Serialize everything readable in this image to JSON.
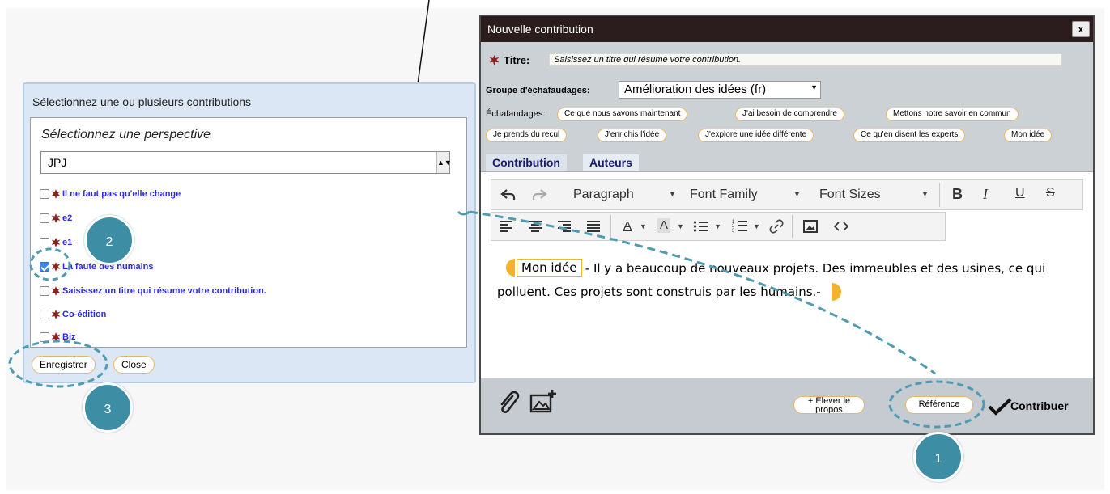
{
  "select_dialog": {
    "title": "Sélectionnez une ou plusieurs contributions",
    "perspective_label": "Sélectionnez une perspective",
    "perspective_value": "JPJ",
    "items": [
      {
        "label": "Il ne faut pas qu'elle change",
        "checked": false
      },
      {
        "label": "e2",
        "checked": false
      },
      {
        "label": "e1",
        "checked": false
      },
      {
        "label": "La faute des humains",
        "checked": true
      },
      {
        "label": "Saisissez un titre qui résume votre contribution.",
        "checked": false
      },
      {
        "label": "Co-édition",
        "checked": false
      },
      {
        "label": "Biz",
        "checked": false
      }
    ],
    "save_label": "Enregistrer",
    "close_label": "Close"
  },
  "editor": {
    "window_title": "Nouvelle contribution",
    "close_glyph": "x",
    "title_label": "Titre:",
    "title_placeholder": "Saisissez un titre qui résume votre contribution.",
    "scaffold_group_label": "Groupe d'échafaudages:",
    "scaffold_group_value": "Amélioration des idées (fr)",
    "scaffolds_label": "Échafaudages:",
    "scaffolds": [
      "Ce que nous savons maintenant",
      "J'ai besoin de comprendre",
      "Mettons notre savoir en commun",
      "Je prends du recul",
      "J'enrichis l'idée",
      "J'explore une idée différente",
      "Ce qu'en disent les experts",
      "Mon idée"
    ],
    "tabs": [
      "Contribution",
      "Auteurs"
    ],
    "toolbar": {
      "paragraph": "Paragraph",
      "font_family": "Font Family",
      "font_sizes": "Font Sizes",
      "bold": "B",
      "italic": "I",
      "underline": "U",
      "strike": "S",
      "text_color": "A",
      "bg_color": "A"
    },
    "body": {
      "scaffold_tag": "Mon idée",
      "text_line1": " - Il y a beaucoup de nouveaux projets. Des immeubles et des usines, ce qui",
      "text_line2": "polluent. Ces projets sont construis par les humains.-"
    },
    "footer": {
      "elevate_label": "+ Élever le propos",
      "reference_label": "Référence",
      "contribute_label": "Contribuer"
    }
  },
  "markers": [
    "1",
    "2",
    "3"
  ],
  "colors": {
    "accent_orange": "#e8a83a",
    "marker_teal": "#3d8ea4",
    "link_blue": "#2b2bdc",
    "titlebar": "#2b1d1d",
    "dashed_teal": "#4f9bb0"
  },
  "icons": [
    "paperclip-icon",
    "image-add-icon",
    "check-icon",
    "undo-icon",
    "redo-icon",
    "link-icon",
    "image-icon",
    "code-icon"
  ]
}
